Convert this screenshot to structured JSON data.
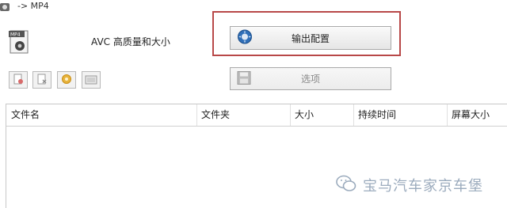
{
  "window": {
    "title": "-> MP4"
  },
  "format": {
    "icon_label": "MP4",
    "description": "AVC 高质量和大小"
  },
  "buttons": {
    "output_config": "输出配置",
    "options": "选项"
  },
  "toolbar": {
    "items": [
      "add-file",
      "remove-file",
      "settings",
      "preview"
    ]
  },
  "table": {
    "columns": [
      "文件名",
      "文件夹",
      "大小",
      "持续时间",
      "屏幕大小"
    ],
    "rows": []
  },
  "watermark": {
    "text": "宝马汽车家京车堡"
  },
  "colors": {
    "highlight": "#b84848"
  }
}
